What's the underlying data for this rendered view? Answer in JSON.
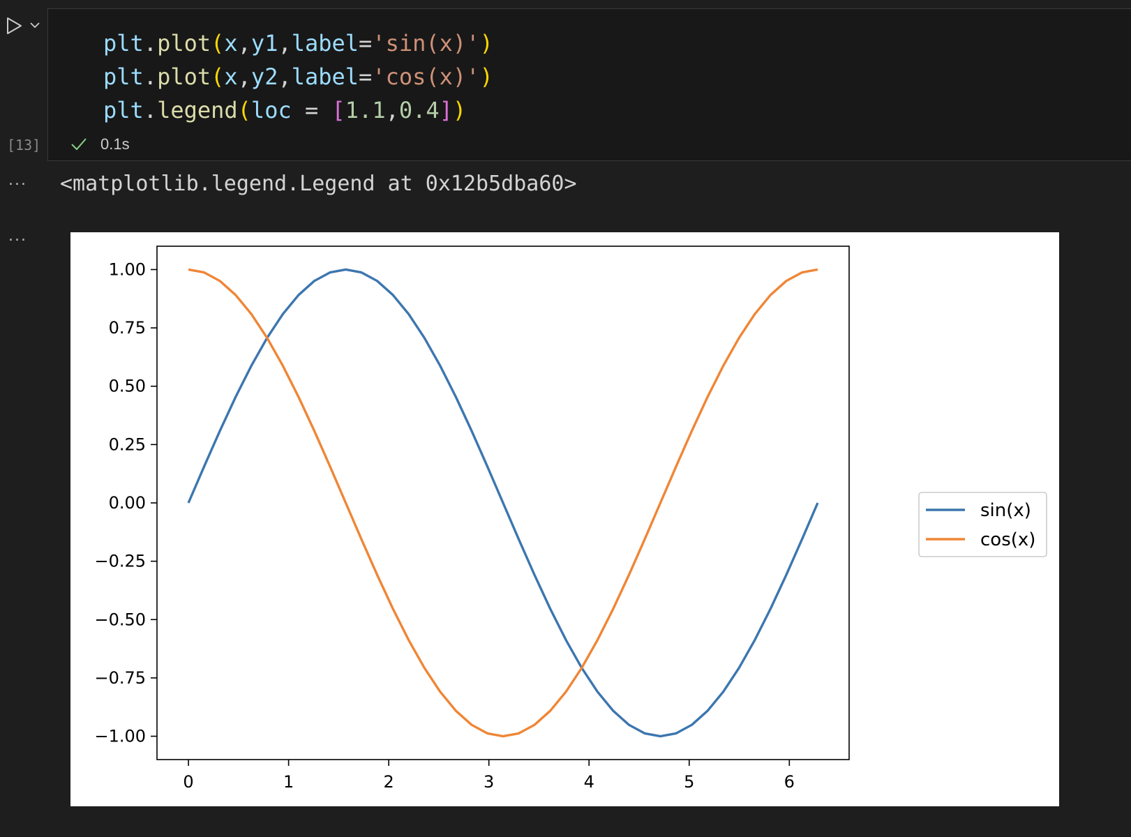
{
  "cell": {
    "execution_count": "[13]",
    "status_time": "0.1s",
    "code_lines": [
      [
        {
          "t": "plt",
          "c": "var"
        },
        {
          "t": ".",
          "c": "op"
        },
        {
          "t": "plot",
          "c": "fn"
        },
        {
          "t": "(",
          "c": "p1"
        },
        {
          "t": "x",
          "c": "var"
        },
        {
          "t": ",",
          "c": "op"
        },
        {
          "t": "y1",
          "c": "var"
        },
        {
          "t": ",",
          "c": "op"
        },
        {
          "t": "label",
          "c": "var"
        },
        {
          "t": "=",
          "c": "op"
        },
        {
          "t": "'sin(x)'",
          "c": "str"
        },
        {
          "t": ")",
          "c": "p1"
        }
      ],
      [
        {
          "t": "plt",
          "c": "var"
        },
        {
          "t": ".",
          "c": "op"
        },
        {
          "t": "plot",
          "c": "fn"
        },
        {
          "t": "(",
          "c": "p1"
        },
        {
          "t": "x",
          "c": "var"
        },
        {
          "t": ",",
          "c": "op"
        },
        {
          "t": "y2",
          "c": "var"
        },
        {
          "t": ",",
          "c": "op"
        },
        {
          "t": "label",
          "c": "var"
        },
        {
          "t": "=",
          "c": "op"
        },
        {
          "t": "'cos(x)'",
          "c": "str"
        },
        {
          "t": ")",
          "c": "p1"
        }
      ],
      [
        {
          "t": "plt",
          "c": "var"
        },
        {
          "t": ".",
          "c": "op"
        },
        {
          "t": "legend",
          "c": "fn"
        },
        {
          "t": "(",
          "c": "p1"
        },
        {
          "t": "loc",
          "c": "var"
        },
        {
          "t": " = ",
          "c": "op"
        },
        {
          "t": "[",
          "c": "p2"
        },
        {
          "t": "1.1",
          "c": "num"
        },
        {
          "t": ",",
          "c": "op"
        },
        {
          "t": "0.4",
          "c": "num"
        },
        {
          "t": "]",
          "c": "p2"
        },
        {
          "t": ")",
          "c": "p1"
        }
      ]
    ]
  },
  "output": {
    "text": "<matplotlib.legend.Legend at 0x12b5dba60>",
    "more_label": "..."
  },
  "icons": {
    "run": "play-icon",
    "expand": "chevron-down-icon",
    "status": "check-icon"
  },
  "colors": {
    "sin": "#3c76af",
    "cos": "#ef8636",
    "success": "#89d185"
  },
  "chart_data": {
    "type": "line",
    "title": "",
    "xlabel": "",
    "ylabel": "",
    "xlim": [
      -0.314,
      6.597
    ],
    "ylim": [
      -1.1,
      1.1
    ],
    "xticks": [
      0,
      1,
      2,
      3,
      4,
      5,
      6
    ],
    "yticks": [
      -1.0,
      -0.75,
      -0.5,
      -0.25,
      0.0,
      0.25,
      0.5,
      0.75,
      1.0
    ],
    "xtick_labels": [
      "0",
      "1",
      "2",
      "3",
      "4",
      "5",
      "6"
    ],
    "ytick_labels": [
      "−1.00",
      "−0.75",
      "−0.50",
      "−0.25",
      "0.00",
      "0.25",
      "0.50",
      "0.75",
      "1.00"
    ],
    "grid": false,
    "legend_position": "outside-right",
    "x": [
      0.0,
      0.1571,
      0.3142,
      0.4712,
      0.6283,
      0.7854,
      0.9425,
      1.0996,
      1.2566,
      1.4137,
      1.5708,
      1.7279,
      1.885,
      2.042,
      2.1991,
      2.3562,
      2.5133,
      2.6704,
      2.8274,
      2.9845,
      3.1416,
      3.2987,
      3.4558,
      3.6128,
      3.7699,
      3.927,
      4.0841,
      4.2412,
      4.3982,
      4.5553,
      4.7124,
      4.8695,
      5.0265,
      5.1836,
      5.3407,
      5.4978,
      5.6549,
      5.8119,
      5.969,
      6.1261,
      6.2832
    ],
    "series": [
      {
        "name": "sin(x)",
        "values": [
          0.0,
          0.1564,
          0.309,
          0.454,
          0.5878,
          0.7071,
          0.809,
          0.891,
          0.9511,
          0.9877,
          1.0,
          0.9877,
          0.9511,
          0.891,
          0.809,
          0.7071,
          0.5878,
          0.454,
          0.309,
          0.1564,
          0.0,
          -0.1564,
          -0.309,
          -0.454,
          -0.5878,
          -0.7071,
          -0.809,
          -0.891,
          -0.9511,
          -0.9877,
          -1.0,
          -0.9877,
          -0.9511,
          -0.891,
          -0.809,
          -0.7071,
          -0.5878,
          -0.454,
          -0.309,
          -0.1564,
          0.0
        ]
      },
      {
        "name": "cos(x)",
        "values": [
          1.0,
          0.9877,
          0.9511,
          0.891,
          0.809,
          0.7071,
          0.5878,
          0.454,
          0.309,
          0.1564,
          0.0,
          -0.1564,
          -0.309,
          -0.454,
          -0.5878,
          -0.7071,
          -0.809,
          -0.891,
          -0.9511,
          -0.9877,
          -1.0,
          -0.9877,
          -0.9511,
          -0.891,
          -0.809,
          -0.7071,
          -0.5878,
          -0.454,
          -0.309,
          -0.1564,
          0.0,
          0.1564,
          0.309,
          0.454,
          0.5878,
          0.7071,
          0.809,
          0.891,
          0.9511,
          0.9877,
          1.0
        ]
      }
    ]
  }
}
